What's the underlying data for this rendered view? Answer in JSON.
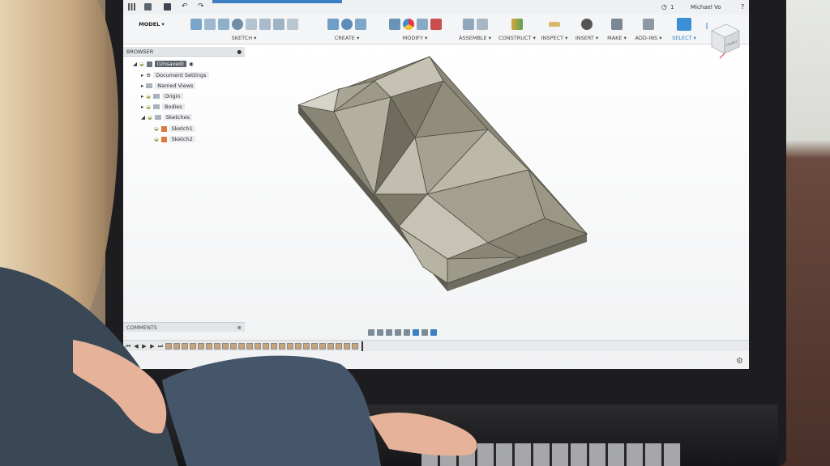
{
  "topbar": {
    "user_name": "Michael Vo",
    "notif_count": "1"
  },
  "toolbar": {
    "model_label": "MODEL",
    "groups": [
      {
        "label": "SKETCH ▾"
      },
      {
        "label": "CREATE ▾"
      },
      {
        "label": "MODIFY ▾"
      },
      {
        "label": "ASSEMBLE ▾"
      },
      {
        "label": "CONSTRUCT ▾"
      },
      {
        "label": "INSPECT ▾"
      },
      {
        "label": "INSERT ▾"
      },
      {
        "label": "MAKE ▾"
      },
      {
        "label": "ADD-INS ▾"
      },
      {
        "label": "SELECT ▾"
      }
    ]
  },
  "browser": {
    "title": "BROWSER",
    "items": [
      {
        "label": "(Unsaved)"
      },
      {
        "label": "Document Settings"
      },
      {
        "label": "Named Views"
      },
      {
        "label": "Origin"
      },
      {
        "label": "Bodies"
      },
      {
        "label": "Sketches"
      },
      {
        "label": "Sketch1"
      },
      {
        "label": "Sketch2"
      }
    ]
  },
  "comments": {
    "title": "COMMENTS"
  },
  "viewcube": {
    "label": "FRONT"
  },
  "colors": {
    "accent": "#2f7fd0",
    "model": "#8a8676",
    "model_side": "#5e5b50"
  }
}
